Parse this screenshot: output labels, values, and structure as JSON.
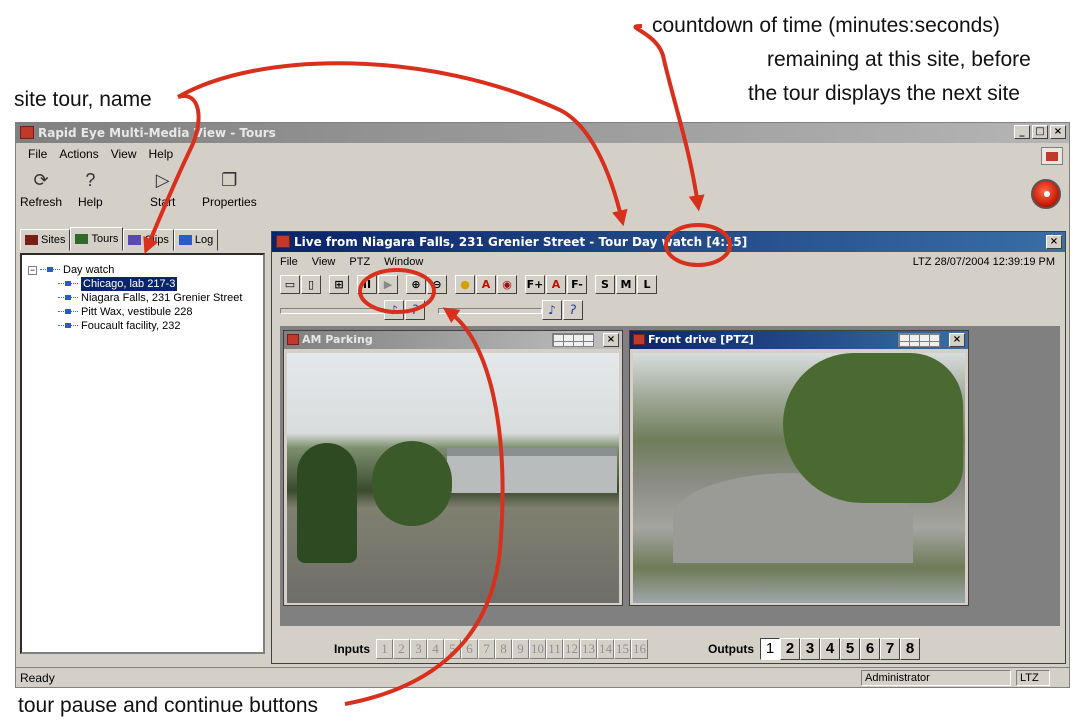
{
  "annotations": {
    "site_tour": "site tour, name",
    "countdown_line1": "countdown of time (minutes:seconds)",
    "countdown_line2": "remaining at this site, before",
    "countdown_line3": "the tour displays the next site",
    "pause_continue": "tour pause and continue buttons",
    "arrow_color": "#d8301c"
  },
  "app": {
    "title": "Rapid Eye Multi-Media View - Tours",
    "menu": [
      "File",
      "Actions",
      "View",
      "Help"
    ],
    "toolbar": [
      {
        "label": "Refresh",
        "icon": "refresh-icon"
      },
      {
        "label": "Help",
        "icon": "question-icon"
      },
      {
        "label": "Start",
        "icon": "play-outline-icon"
      },
      {
        "label": "Properties",
        "icon": "properties-icon"
      }
    ],
    "tabs": [
      "Sites",
      "Tours",
      "Clips",
      "Log"
    ],
    "active_tab": "Tours",
    "tree": {
      "root": "Day watch",
      "children": [
        "Chicago, lab 217-3",
        "Niagara Falls, 231 Grenier Street",
        "Pitt Wax, vestibule 228",
        "Foucault facility, 232"
      ],
      "selected": "Chicago, lab 217-3"
    },
    "status": {
      "left": "Ready",
      "user": "Administrator",
      "zone": "LTZ"
    }
  },
  "live": {
    "title": "Live from Niagara Falls, 231 Grenier Street - Tour Day watch [4:15]",
    "menu": [
      "File",
      "View",
      "PTZ",
      "Window"
    ],
    "timestamp": "LTZ 28/07/2004 12:39:19 PM",
    "buttons": {
      "pause": "II",
      "play": "▶",
      "f_plus": "F+",
      "f_minus": "F-",
      "s": "S",
      "m": "M",
      "l": "L"
    },
    "cameras": [
      {
        "name": "AM Parking",
        "active": false
      },
      {
        "name": "Front drive [PTZ]",
        "active": true
      }
    ],
    "inputs_label": "Inputs",
    "inputs": [
      "1",
      "2",
      "3",
      "4",
      "5",
      "6",
      "7",
      "8",
      "9",
      "10",
      "11",
      "12",
      "13",
      "14",
      "15",
      "16"
    ],
    "outputs_label": "Outputs",
    "outputs": [
      "1",
      "2",
      "3",
      "4",
      "5",
      "6",
      "7",
      "8"
    ]
  }
}
